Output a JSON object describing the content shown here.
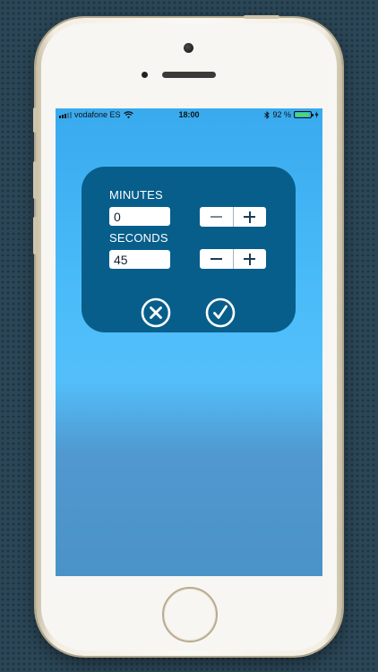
{
  "status_bar": {
    "carrier": "vodafone ES",
    "time": "18:00",
    "battery": "92 %",
    "battery_level": 0.92
  },
  "dialog": {
    "minutes_label": "MINUTES",
    "minutes_value": "0",
    "seconds_label": "SECONDS",
    "seconds_value": "45"
  },
  "icons": {
    "cancel": "close-circle-icon",
    "confirm": "check-circle-icon"
  },
  "colors": {
    "dialog_bg": "#075e8a",
    "screen_top": "#38aaee",
    "screen_bottom": "#4a93c8",
    "battery_fill": "#4cd964"
  }
}
